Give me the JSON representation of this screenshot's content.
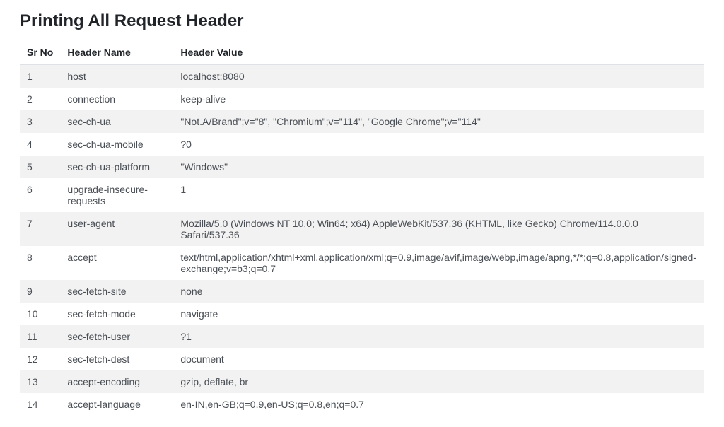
{
  "title": "Printing All Request Header",
  "columns": {
    "sr": "Sr No",
    "name": "Header Name",
    "value": "Header Value"
  },
  "rows": [
    {
      "sr": "1",
      "name": "host",
      "value": "localhost:8080"
    },
    {
      "sr": "2",
      "name": "connection",
      "value": "keep-alive"
    },
    {
      "sr": "3",
      "name": "sec-ch-ua",
      "value": "\"Not.A/Brand\";v=\"8\", \"Chromium\";v=\"114\", \"Google Chrome\";v=\"114\""
    },
    {
      "sr": "4",
      "name": "sec-ch-ua-mobile",
      "value": "?0"
    },
    {
      "sr": "5",
      "name": "sec-ch-ua-platform",
      "value": "\"Windows\""
    },
    {
      "sr": "6",
      "name": "upgrade-insecure-requests",
      "value": "1"
    },
    {
      "sr": "7",
      "name": "user-agent",
      "value": "Mozilla/5.0 (Windows NT 10.0; Win64; x64) AppleWebKit/537.36 (KHTML, like Gecko) Chrome/114.0.0.0 Safari/537.36"
    },
    {
      "sr": "8",
      "name": "accept",
      "value": "text/html,application/xhtml+xml,application/xml;q=0.9,image/avif,image/webp,image/apng,*/*;q=0.8,application/signed-exchange;v=b3;q=0.7"
    },
    {
      "sr": "9",
      "name": "sec-fetch-site",
      "value": "none"
    },
    {
      "sr": "10",
      "name": "sec-fetch-mode",
      "value": "navigate"
    },
    {
      "sr": "11",
      "name": "sec-fetch-user",
      "value": "?1"
    },
    {
      "sr": "12",
      "name": "sec-fetch-dest",
      "value": "document"
    },
    {
      "sr": "13",
      "name": "accept-encoding",
      "value": "gzip, deflate, br"
    },
    {
      "sr": "14",
      "name": "accept-language",
      "value": "en-IN,en-GB;q=0.9,en-US;q=0.8,en;q=0.7"
    }
  ]
}
